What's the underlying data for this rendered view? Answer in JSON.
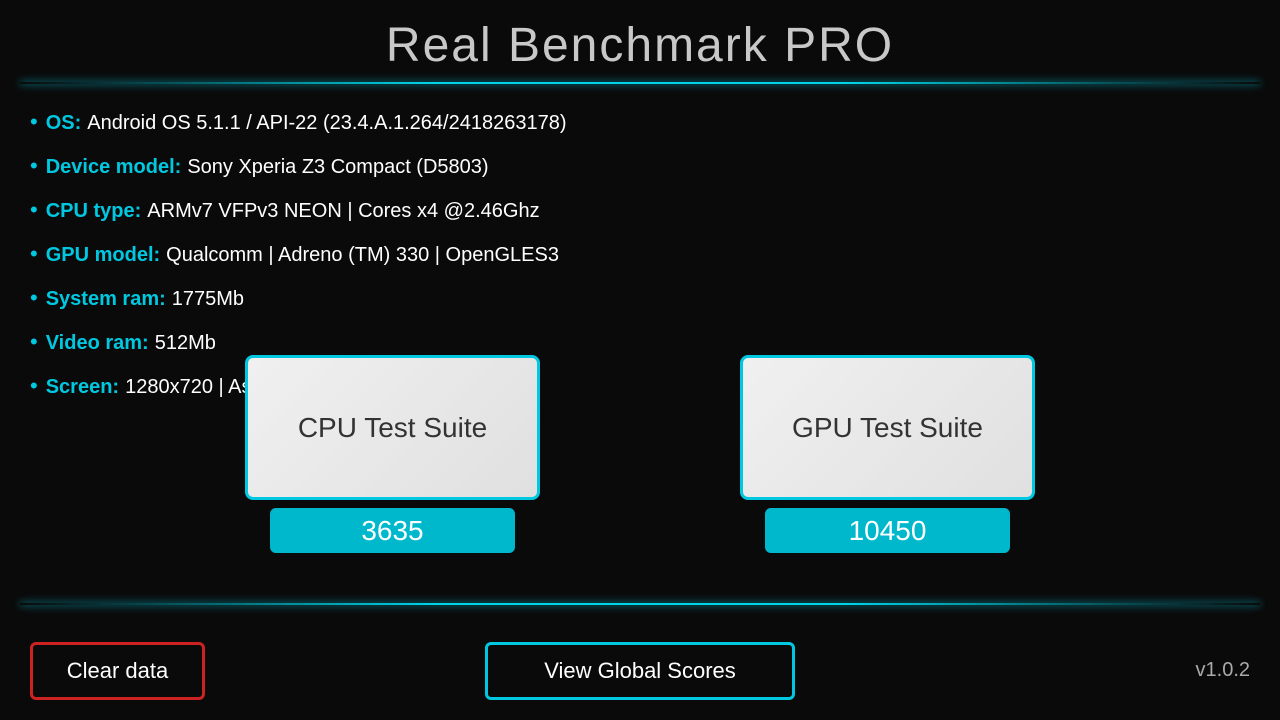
{
  "app": {
    "title": "Real Benchmark PRO",
    "version": "v1.0.2"
  },
  "device_info": {
    "os": {
      "label": "OS:",
      "value": "Android OS 5.1.1 / API-22 (23.4.A.1.264/2418263178)"
    },
    "device_model": {
      "label": "Device model:",
      "value": "Sony Xperia Z3 Compact (D5803)"
    },
    "cpu_type": {
      "label": "CPU type:",
      "value": "ARMv7 VFPv3 NEON | Cores x4 @2.46Ghz"
    },
    "gpu_model": {
      "label": "GPU model:",
      "value": "Qualcomm | Adreno (TM) 330 | OpenGLES3"
    },
    "system_ram": {
      "label": "System ram:",
      "value": "1775Mb"
    },
    "video_ram": {
      "label": "Video ram:",
      "value": "512Mb"
    },
    "screen": {
      "label": "Screen:",
      "value": "1280x720 | Aspect-Ratio 16:9 | dpi 326"
    }
  },
  "tests": {
    "cpu": {
      "label": "CPU Test Suite",
      "score": "3635"
    },
    "gpu": {
      "label": "GPU Test Suite",
      "score": "10450"
    }
  },
  "buttons": {
    "clear_data": "Clear data",
    "view_global_scores": "View Global Scores"
  }
}
